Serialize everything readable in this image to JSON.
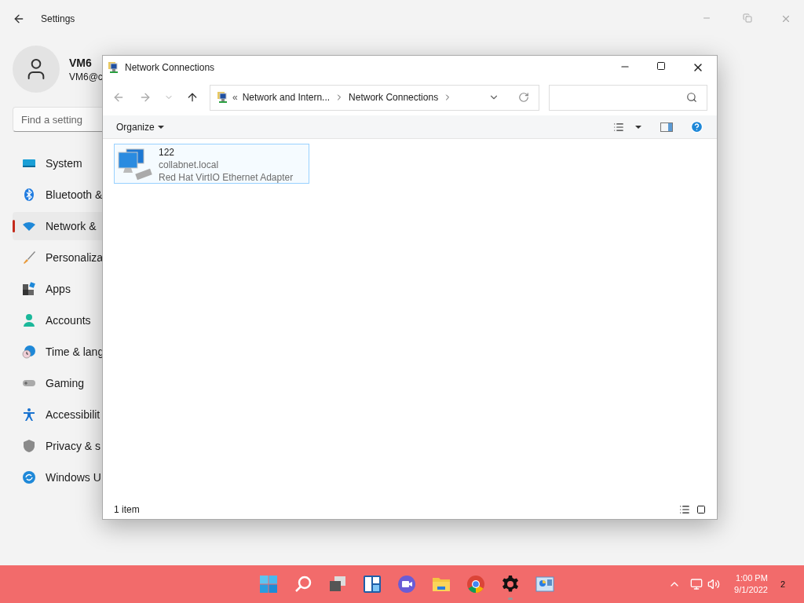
{
  "settings": {
    "title": "Settings",
    "user": {
      "name": "VM6",
      "email": "VM6@c"
    },
    "search": {
      "placeholder": "Find a setting"
    },
    "nav": [
      {
        "label": "System",
        "selected": false
      },
      {
        "label": "Bluetooth &",
        "selected": false
      },
      {
        "label": "Network &",
        "selected": true
      },
      {
        "label": "Personaliza",
        "selected": false
      },
      {
        "label": "Apps",
        "selected": false
      },
      {
        "label": "Accounts",
        "selected": false
      },
      {
        "label": "Time & lang",
        "selected": false
      },
      {
        "label": "Gaming",
        "selected": false
      },
      {
        "label": "Accessibilit",
        "selected": false
      },
      {
        "label": "Privacy & s",
        "selected": false
      },
      {
        "label": "Windows U",
        "selected": false
      }
    ]
  },
  "explorer": {
    "title": "Network Connections",
    "address": {
      "prefix": "«",
      "crumbs": [
        "Network and Intern...",
        "Network Connections"
      ]
    },
    "organize": "Organize",
    "items": [
      {
        "name": "122",
        "network": "collabnet.local",
        "adapter": "Red Hat VirtIO Ethernet Adapter",
        "selected": true
      }
    ],
    "status": "1 item"
  },
  "taskbar": {
    "apps": [
      {
        "running": false
      },
      {
        "running": false
      },
      {
        "running": false
      },
      {
        "running": false
      },
      {
        "running": false
      },
      {
        "running": false
      },
      {
        "running": false
      },
      {
        "running": true
      },
      {
        "running": false
      }
    ],
    "time": "1:00 PM",
    "date": "9/1/2022",
    "notifications": "2"
  }
}
